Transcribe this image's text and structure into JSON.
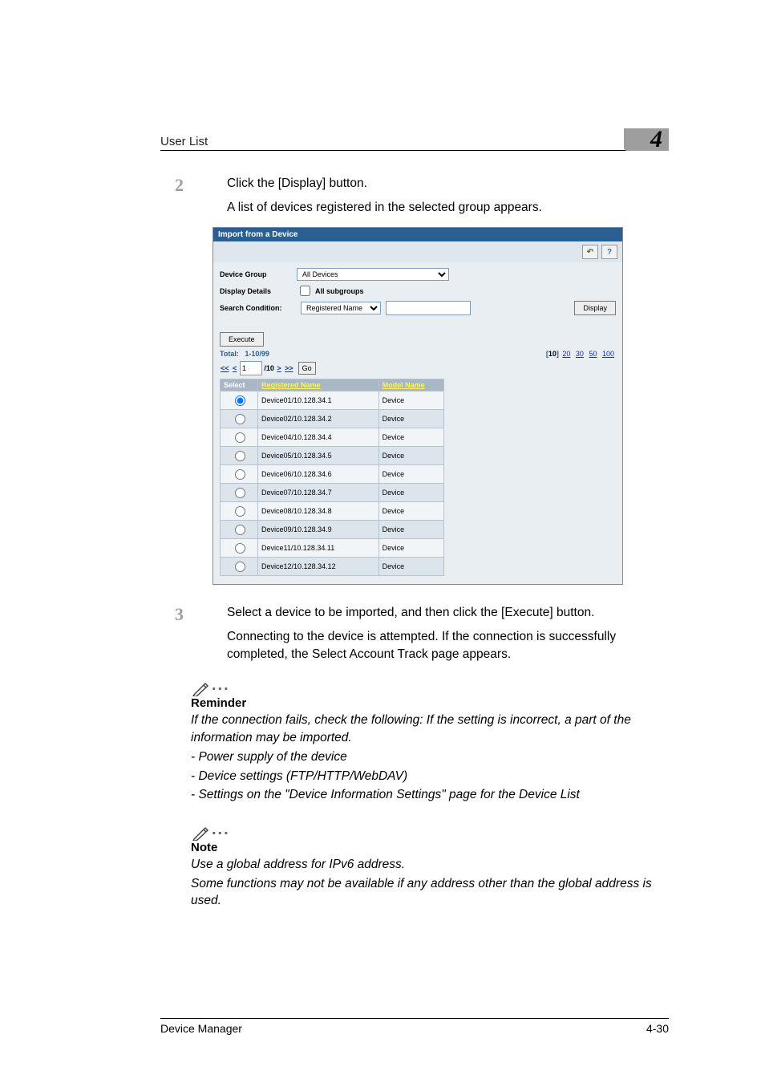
{
  "header": {
    "section": "User List",
    "chapter": "4"
  },
  "steps": {
    "s2": {
      "num": "2",
      "line1": "Click the [Display] button.",
      "line2": "A list of devices registered in the selected group appears."
    },
    "s3": {
      "num": "3",
      "line1": "Select a device to be imported, and then click the [Execute] button.",
      "line2": "Connecting to the device is attempted. If the connection is successfully completed, the Select Account Track page appears."
    }
  },
  "screenshot": {
    "title": "Import from a Device",
    "help_btn": "?",
    "back_btn": "↶",
    "form": {
      "device_group_label": "Device Group",
      "device_group_value": "All Devices",
      "display_details_label": "Display Details",
      "display_details_value": "All subgroups",
      "search_condition_label": "Search Condition:",
      "search_condition_value": "Registered Name",
      "display_button": "Display",
      "execute_button": "Execute"
    },
    "results": {
      "total_label": "Total:",
      "total_range": "1-10/99",
      "page_sizes": [
        "10",
        "20",
        "30",
        "50",
        "100"
      ],
      "pager": {
        "first": "<<",
        "prev": "<",
        "current": "1",
        "of": "/10",
        "next": ">",
        "last": ">>",
        "go": "Go"
      },
      "columns": [
        "Select",
        "Registered Name",
        "Model Name"
      ],
      "rows": [
        {
          "name": "Device01/10.128.34.1",
          "model": "Device",
          "selected": true
        },
        {
          "name": "Device02/10.128.34.2",
          "model": "Device",
          "selected": false
        },
        {
          "name": "Device04/10.128.34.4",
          "model": "Device",
          "selected": false
        },
        {
          "name": "Device05/10.128.34.5",
          "model": "Device",
          "selected": false
        },
        {
          "name": "Device06/10.128.34.6",
          "model": "Device",
          "selected": false
        },
        {
          "name": "Device07/10.128.34.7",
          "model": "Device",
          "selected": false
        },
        {
          "name": "Device08/10.128.34.8",
          "model": "Device",
          "selected": false
        },
        {
          "name": "Device09/10.128.34.9",
          "model": "Device",
          "selected": false
        },
        {
          "name": "Device11/10.128.34.11",
          "model": "Device",
          "selected": false
        },
        {
          "name": "Device12/10.128.34.12",
          "model": "Device",
          "selected": false
        }
      ]
    }
  },
  "reminder": {
    "heading": "Reminder",
    "p1": "If the connection fails, check the following: If the setting is incorrect, a part of the information may be imported.",
    "b1": "- Power supply of the device",
    "b2": "- Device settings (FTP/HTTP/WebDAV)",
    "b3": "- Settings on the \"Device Information Settings\" page for the Device List"
  },
  "note": {
    "heading": "Note",
    "p1": "Use a global address for IPv6 address.",
    "p2": "Some functions may not be available if any address other than the global address is used."
  },
  "footer": {
    "product": "Device Manager",
    "page": "4-30"
  }
}
